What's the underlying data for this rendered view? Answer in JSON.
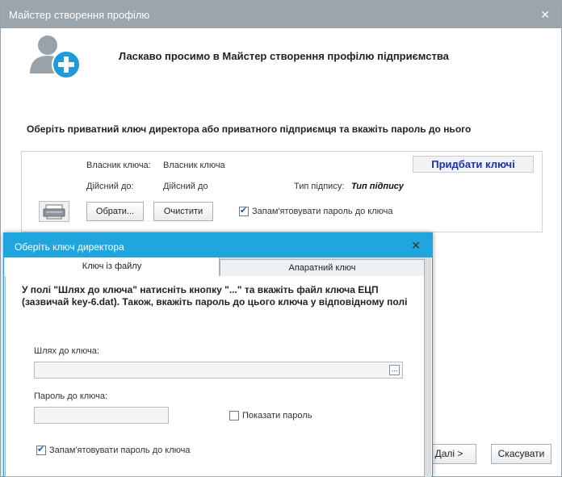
{
  "main_window": {
    "title": "Майстер створення профілю",
    "close_glyph": "✕",
    "welcome": "Ласкаво просимо в Майстер створення профілю підприємства",
    "instruction": "Оберіть приватний ключ директора або приватного підприємця та вкажіть пароль до нього",
    "key_panel": {
      "owner_label": "Власник ключа:",
      "owner_value": "Власник ключа",
      "valid_label": "Дійсний до:",
      "valid_value": "Дійсний до",
      "sig_type_label": "Тип підпису:",
      "sig_type_value": "Тип підпису",
      "add_keys_button": "Придбати ключі",
      "choose_button": "Обрати...",
      "clear_button": "Очистити",
      "remember_password_label": "Запам'ятовувати пароль до ключа",
      "remember_password_checked": true
    },
    "next_button": "Далі >",
    "cancel_button": "Скасувати"
  },
  "dialog": {
    "title": "Оберіть ключ директора",
    "close_glyph": "✕",
    "tabs": [
      {
        "label": "Ключ із файлу",
        "active": true
      },
      {
        "label": "Апаратний ключ",
        "active": false
      }
    ],
    "instruction": "У полі \"Шлях до ключа\" натисніть кнопку \"...\" та вкажіть файл ключа ЕЦП (зазвичай key-6.dat). Також, вкажіть пароль до цього ключа у відповідному полі",
    "key_path_label": "Шлях до ключа:",
    "key_path_value": "",
    "browse_button": "...",
    "password_label": "Пароль до ключа:",
    "password_value": "",
    "show_password_label": "Показати пароль",
    "show_password_checked": false,
    "remember_password_label": "Запам'ятовувати пароль до ключа",
    "remember_password_checked": true
  },
  "icons": {
    "avatar": "add-user-icon",
    "scanner": "scanner-icon"
  },
  "colors": {
    "main_titlebar": "#9aa5ae",
    "dialog_titlebar": "#1fa6de",
    "add_keys_text": "#1a2fb8",
    "plus_badge": "#1f9bd7"
  }
}
